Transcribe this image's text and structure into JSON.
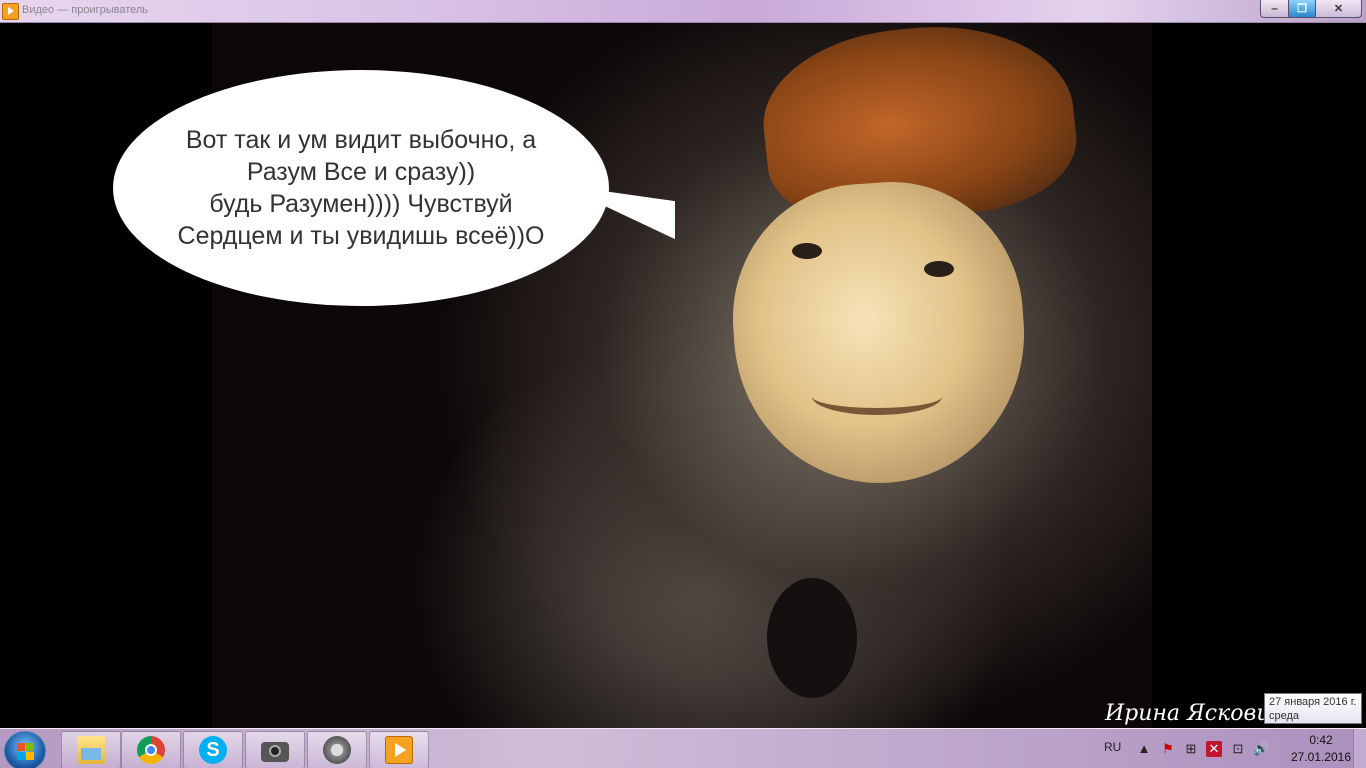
{
  "window": {
    "title": "Видео — проигрыватель",
    "buttons": {
      "minimize": "‒",
      "maximize": "❐",
      "close": "✕"
    }
  },
  "bubble": {
    "lines": [
      "Вот так и ум видит выбочно, а",
      "Разум Все и сразу))",
      "будь Разумен)))) Чувствуй",
      "Сердцем и ты увидишь всеё))О"
    ]
  },
  "signature": "Ирина Яскович",
  "taskbar": {
    "apps": [
      {
        "name": "explorer-icon"
      },
      {
        "name": "chrome-icon"
      },
      {
        "name": "skype-icon",
        "glyph": "S"
      },
      {
        "name": "camera-icon"
      },
      {
        "name": "movie-maker-icon"
      },
      {
        "name": "media-player-icon"
      }
    ],
    "language": "RU",
    "tray_icons": {
      "arrow": "▲",
      "flag": "⚑",
      "windows": "⊞",
      "red": "✕",
      "network": "⊡",
      "volume": "🔊"
    },
    "clock": {
      "time": "0:42",
      "date": "27.01.2016"
    }
  },
  "tooltip": {
    "line1": "27 января 2016 г.",
    "line2": "среда"
  },
  "colors": {
    "bubble": "#ffffff",
    "bubble_text": "#333333",
    "background": "#000000",
    "accent_orange": "#f4a21f"
  }
}
